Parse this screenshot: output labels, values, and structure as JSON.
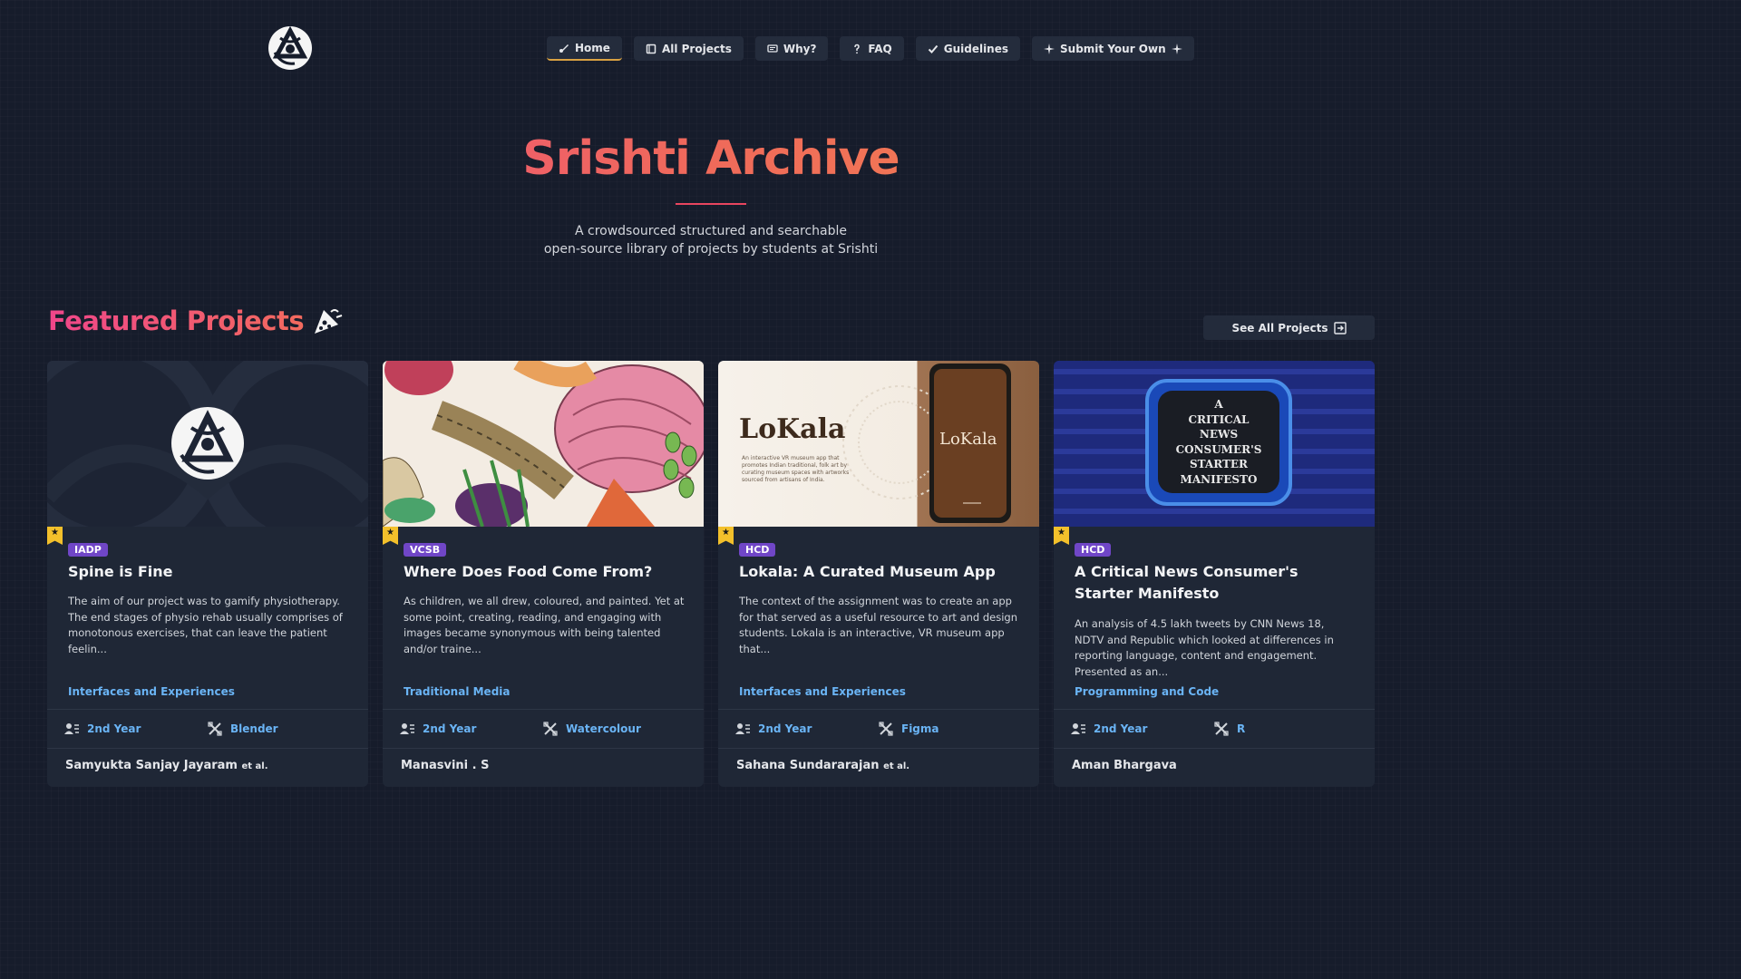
{
  "nav": {
    "items": [
      {
        "label": "Home",
        "icon": "brush-icon",
        "active": true
      },
      {
        "label": "All Projects",
        "icon": "book-icon",
        "active": false
      },
      {
        "label": "Why?",
        "icon": "chat-icon",
        "active": false
      },
      {
        "label": "FAQ",
        "icon": "question-icon",
        "active": false
      },
      {
        "label": "Guidelines",
        "icon": "check-icon",
        "active": false
      },
      {
        "label": "Submit Your Own",
        "icon": "sparkle-icon",
        "active": false
      }
    ]
  },
  "hero": {
    "title": "Srishti Archive",
    "subtitle_line1": "A crowdsourced structured and searchable",
    "subtitle_line2": "open-source library of projects by students at Srishti"
  },
  "featured": {
    "heading": "Featured Projects",
    "see_all": "See All Projects"
  },
  "colors": {
    "background": "#161c2b",
    "card": "#1f2736",
    "accent_pink": "#f0468a",
    "accent_orange": "#f2904a",
    "badge": "#7046c7",
    "link": "#6ab4f5",
    "star": "#f3c02b"
  },
  "cards": [
    {
      "badge": "IADP",
      "title": "Spine is Fine",
      "description": "The aim of our project was to gamify physiotherapy. The end stages of physio rehab usually comprises of monotonous exercises, that can leave the patient feelin...",
      "category": "Interfaces and Experiences",
      "year": "2nd Year",
      "tool": "Blender",
      "author": "Samyukta Sanjay Jayaram",
      "etal": "et al."
    },
    {
      "badge": "VCSB",
      "title": "Where Does Food Come From?",
      "description": "As children, we all drew, coloured, and painted. Yet at some point, creating, reading, and engaging with images became synonymous with being talented and/or traine...",
      "category": "Traditional Media",
      "year": "2nd Year",
      "tool": "Watercolour",
      "author": "Manasvini . S",
      "etal": ""
    },
    {
      "badge": "HCD",
      "title": "Lokala: A Curated Museum App",
      "description": "The context of the assignment was to create an app for that served as a useful resource to art and design students. Lokala is an interactive, VR museum app that...",
      "category": "Interfaces and Experiences",
      "year": "2nd Year",
      "tool": "Figma",
      "author": "Sahana Sundararajan",
      "etal": "et al.",
      "image_text": {
        "brand": "LoKala",
        "phone_brand": "LoKala",
        "blurb": "An interactive VR museum app that promotes Indian traditional, folk art by curating museum spaces with artworks sourced from artisans of India."
      }
    },
    {
      "badge": "HCD",
      "title": "A Critical News Consumer's Starter Manifesto",
      "description": "An analysis of 4.5 lakh tweets by CNN News 18, NDTV and Republic which looked at differences in reporting language, content and engagement. Presented as an...",
      "category": "Programming and Code",
      "year": "2nd Year",
      "tool": "R",
      "author": "Aman Bhargava",
      "etal": "",
      "image_text": {
        "tv_line1": "A",
        "tv_line2": "CRITICAL",
        "tv_line3": "NEWS",
        "tv_line4": "CONSUMER'S",
        "tv_line5": "STARTER",
        "tv_line6": "MANIFESTO"
      }
    }
  ]
}
